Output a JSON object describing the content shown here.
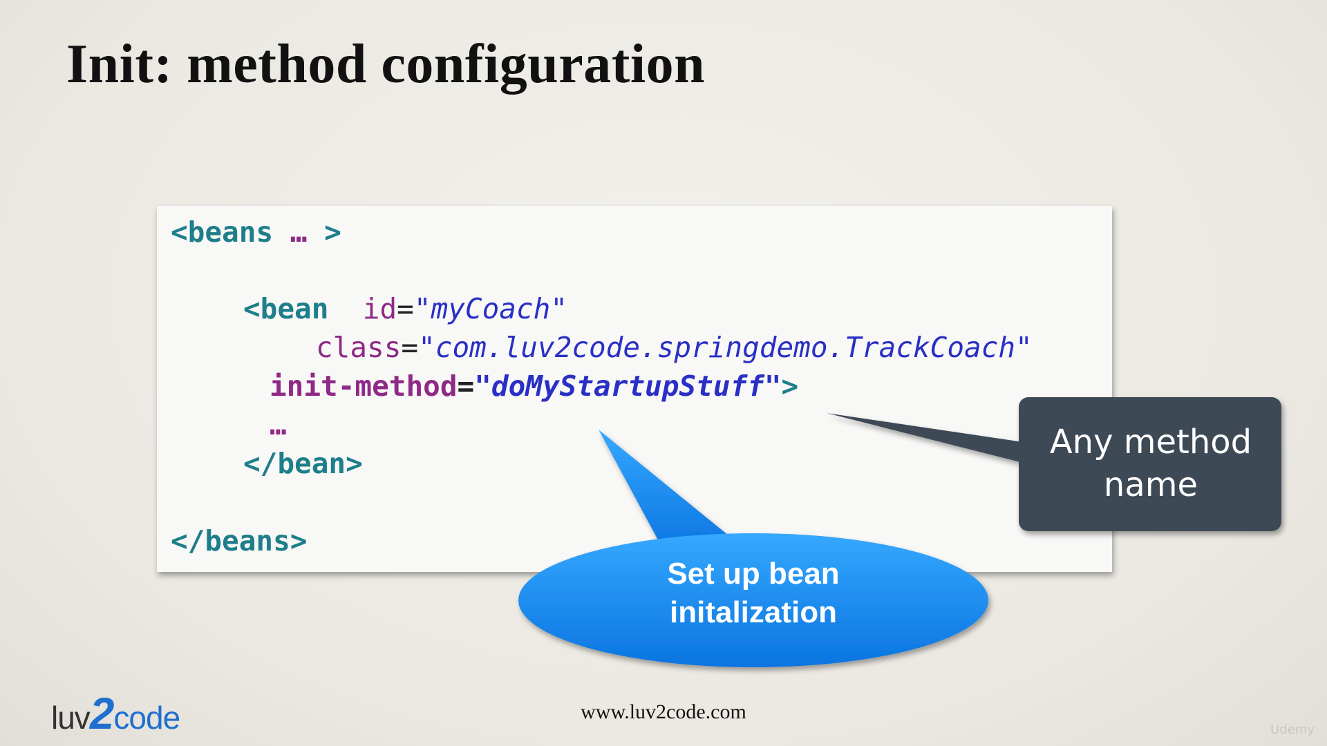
{
  "slide": {
    "title": "Init: method configuration",
    "footer_url": "www.luv2code.com",
    "logo": {
      "part1": "luv",
      "part2": "2",
      "part3": "code"
    },
    "watermark": "Udemy"
  },
  "code": {
    "beans_open": "<beans",
    "ellipsis": "…",
    "beans_open_close": ">",
    "bean_open": "<bean",
    "id_attr": "id",
    "id_value": "\"myCoach\"",
    "class_attr": "class",
    "class_value": "\"com.luv2code.springdemo.TrackCoach\"",
    "init_attr": "init-method",
    "init_value": "\"doMyStartupStuff\"",
    "tag_close": ">",
    "body_ellipsis": "…",
    "bean_close": "</bean>",
    "beans_close": "</beans>",
    "equals": "="
  },
  "callouts": {
    "method_name": {
      "line1": "Any method",
      "line2": "name"
    },
    "setup": {
      "line1": "Set up bean",
      "line2": "initalization"
    }
  }
}
